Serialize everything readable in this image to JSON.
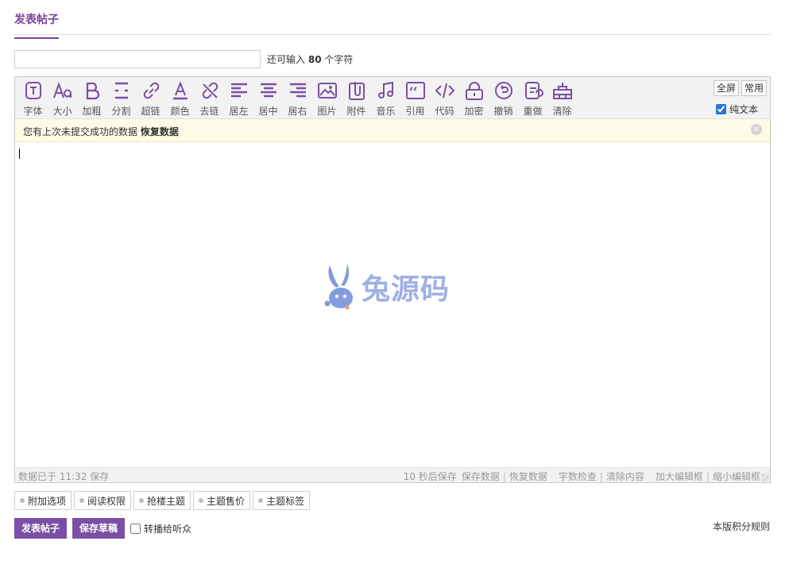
{
  "header": {
    "tab_title": "发表帖子"
  },
  "subject": {
    "value": "",
    "placeholder": "",
    "remaining_prefix": "还可输入",
    "remaining_count": "80",
    "remaining_suffix": "个字符"
  },
  "toolbar": {
    "tools": [
      {
        "label": "字体",
        "icon": "font-icon"
      },
      {
        "label": "大小",
        "icon": "font-size-icon"
      },
      {
        "label": "加粗",
        "icon": "bold-icon"
      },
      {
        "label": "分割",
        "icon": "divider-icon"
      },
      {
        "label": "超链",
        "icon": "link-icon"
      },
      {
        "label": "颜色",
        "icon": "font-color-icon"
      },
      {
        "label": "去链",
        "icon": "unlink-icon"
      },
      {
        "label": "居左",
        "icon": "align-left-icon"
      },
      {
        "label": "居中",
        "icon": "align-center-icon"
      },
      {
        "label": "居右",
        "icon": "align-right-icon"
      },
      {
        "label": "图片",
        "icon": "image-icon"
      },
      {
        "label": "附件",
        "icon": "attachment-icon"
      },
      {
        "label": "音乐",
        "icon": "music-icon"
      },
      {
        "label": "引用",
        "icon": "quote-icon"
      },
      {
        "label": "代码",
        "icon": "code-icon"
      },
      {
        "label": "加密",
        "icon": "lock-icon"
      },
      {
        "label": "撤销",
        "icon": "undo-icon"
      },
      {
        "label": "重做",
        "icon": "redo-icon"
      },
      {
        "label": "清除",
        "icon": "clear-format-icon"
      }
    ],
    "fullscreen_label": "全屏",
    "common_label": "常用",
    "plain_text_label": "纯文本",
    "plain_text_checked": true,
    "icon_color": "#7b4fa3"
  },
  "notice": {
    "text": "您有上次未提交成功的数据",
    "restore_label": "恢复数据"
  },
  "watermark": {
    "text": "兔源码"
  },
  "statusbar": {
    "saved_text": "数据已于 11:32 保存",
    "autosave_text": "10 秒后保存",
    "save_data": "保存数据",
    "restore_data": "恢复数据",
    "word_check": "字数检查",
    "clear_content": "清除内容",
    "enlarge": "加大编辑框",
    "shrink": "缩小编辑框"
  },
  "options": [
    {
      "label": "附加选项"
    },
    {
      "label": "阅读权限"
    },
    {
      "label": "抢楼主题"
    },
    {
      "label": "主题售价"
    },
    {
      "label": "主题标签"
    }
  ],
  "actions": {
    "post_label": "发表帖子",
    "draft_label": "保存草稿",
    "share_label": "转播给听众",
    "share_checked": false,
    "rules_label": "本版积分规则"
  },
  "colors": {
    "accent": "#7b4fa3",
    "tab_accent": "#7b3f95",
    "notice_bg": "#fdfbe5"
  }
}
